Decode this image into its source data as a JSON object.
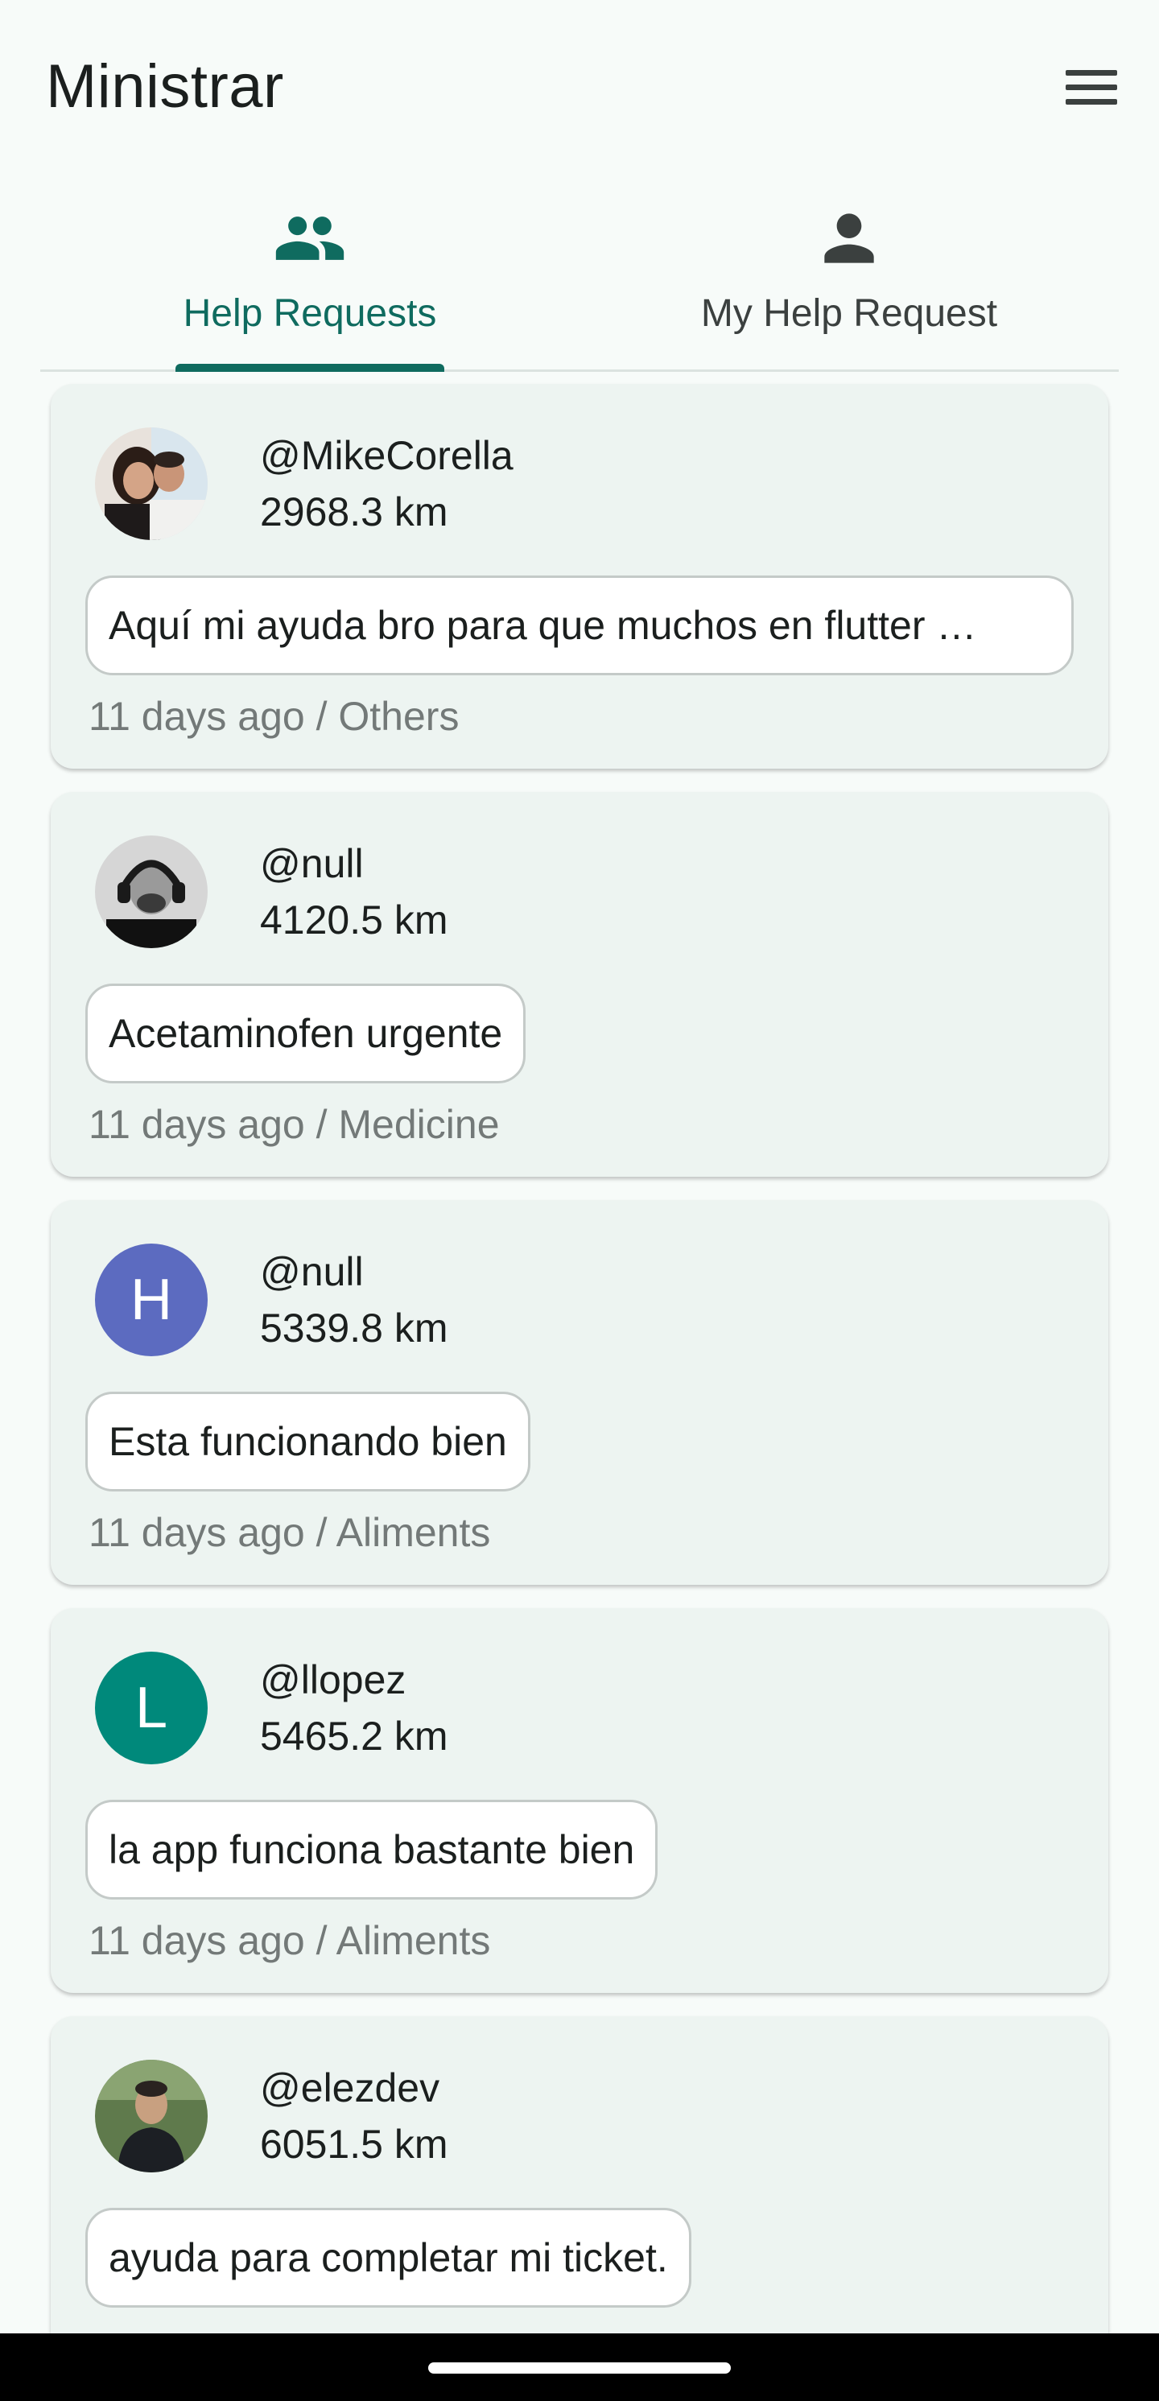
{
  "app": {
    "title": "Ministrar",
    "menu_icon": "menu-icon"
  },
  "tabs": [
    {
      "label": "Help Requests",
      "icon": "people-icon",
      "selected": true
    },
    {
      "label": "My Help Request",
      "icon": "person-icon",
      "selected": false
    }
  ],
  "colors": {
    "primary": "#0f6b5f",
    "card_background": "#edf4f1",
    "page_background": "#f7fbf9",
    "meta_text": "#737978",
    "avatar_h": "#5c6bc0",
    "avatar_l": "#00897b"
  },
  "feed": {
    "items": [
      {
        "user": "@MikeCorella",
        "distance": "2968.3 km",
        "message": "Aquí mi ayuda bro para que muchos en flutter …",
        "meta": "11 days ago / Others",
        "avatar": {
          "type": "photo",
          "icon": "couple-photo-avatar"
        }
      },
      {
        "user": "@null",
        "distance": "4120.5 km",
        "message": "Acetaminofen urgente",
        "meta": "11 days ago / Medicine",
        "avatar": {
          "type": "photo",
          "icon": "headphones-man-photo-avatar"
        }
      },
      {
        "user": "@null",
        "distance": "5339.8 km",
        "message": "Esta funcionando bien",
        "meta": "11 days ago / Aliments",
        "avatar": {
          "type": "letter",
          "letter": "H",
          "color": "#5c6bc0"
        }
      },
      {
        "user": "@llopez",
        "distance": "5465.2 km",
        "message": "la app funciona bastante bien",
        "meta": "11 days ago / Aliments",
        "avatar": {
          "type": "letter",
          "letter": "L",
          "color": "#00897b"
        }
      },
      {
        "user": "@elezdev",
        "distance": "6051.5 km",
        "message": "ayuda para completar mi ticket.",
        "meta": "",
        "avatar": {
          "type": "photo",
          "icon": "outdoor-man-photo-avatar"
        }
      }
    ]
  }
}
